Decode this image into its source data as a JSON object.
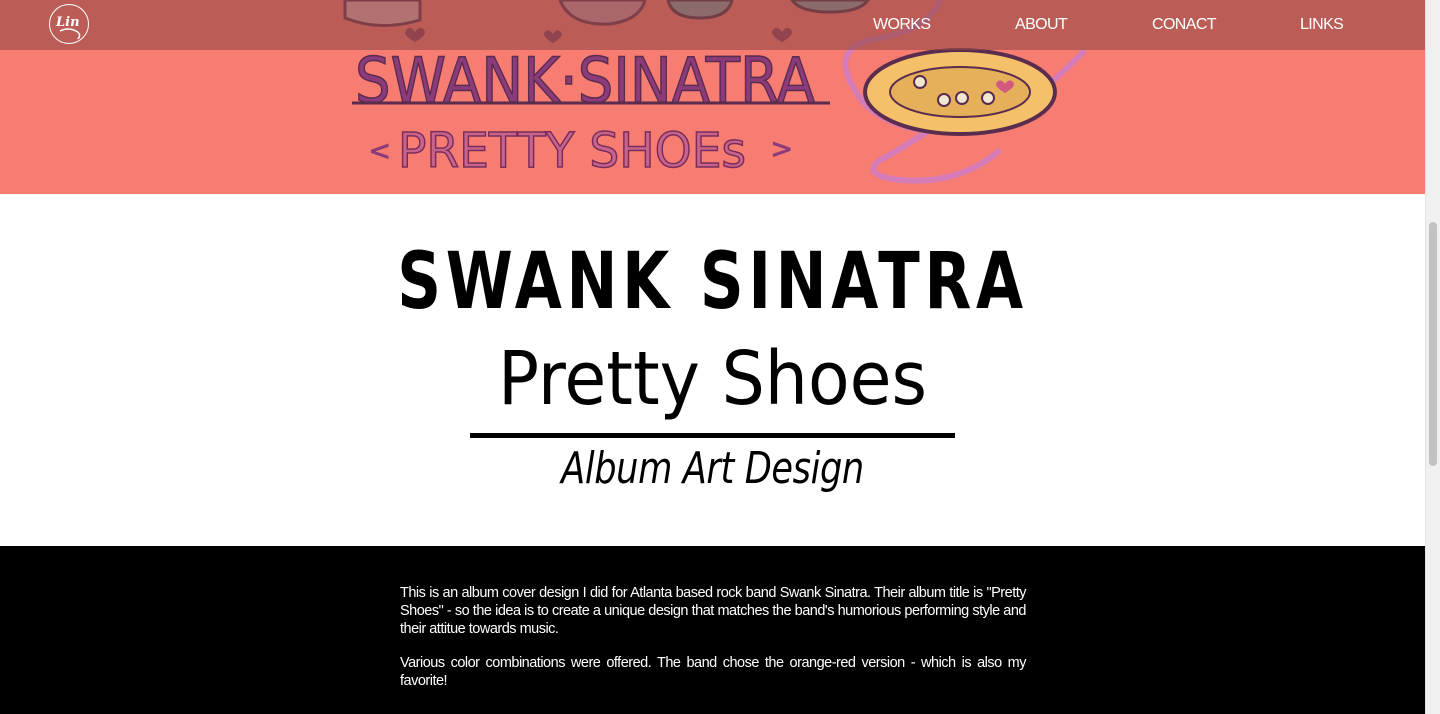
{
  "nav": {
    "logo_text": "Lin",
    "items": [
      {
        "label": "WORKS"
      },
      {
        "label": "ABOUT"
      },
      {
        "label": "CONACT"
      },
      {
        "label": "LINKS"
      }
    ]
  },
  "hero": {
    "art_band_text": "SWANK·SINATRA",
    "art_album_text": "PRETTY SHOEs",
    "art_left_arrow": "<",
    "art_right_arrow": ">",
    "background_color": "#f77d72"
  },
  "title": {
    "band": "SWANK SINATRA",
    "album": "Pretty Shoes",
    "subtitle": "Album Art Design"
  },
  "description": {
    "paragraphs": [
      "This is an album cover design I did for Atlanta based rock band Swank Sinatra. Their album title is \"Pretty Shoes\" - so the idea is to create a unique design that matches the band's humorious performing style and their attitue towards music.",
      "Various color combinations were offered. The band chose the orange-red version - which is also my favorite!"
    ]
  },
  "colors": {
    "accent": "#f77d72",
    "nav_overlay": "#964b46",
    "text_dark": "#000000",
    "text_light": "#ffffff"
  }
}
